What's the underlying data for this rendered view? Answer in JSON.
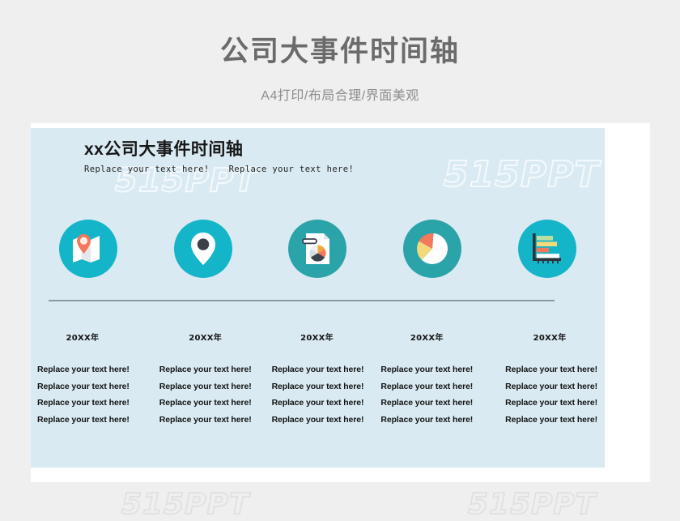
{
  "page": {
    "title": "公司大事件时间轴",
    "subtitle": "A4打印/布局合理/界面美观",
    "background_color": "#efefef",
    "title_color": "#6b6b6b",
    "subtitle_color": "#8d8d8d"
  },
  "watermarks": {
    "text": "515PPT",
    "slide_1": "515PPT",
    "slide_2": "515PPT",
    "page_1": "515PPT",
    "page_2": "515PPT"
  },
  "slide": {
    "background_color": "#d9eaf2",
    "card_color": "#ffffff",
    "title": "xx公司大事件时间轴",
    "subtitles": [
      "Replace your text here!",
      "Replace your text here!"
    ],
    "timeline_line_color": "#8c9aa0",
    "icons": [
      {
        "name": "map-with-pin-icon",
        "circle_color": "#14b5c8",
        "accent_color": "#f4785c"
      },
      {
        "name": "location-pin-icon",
        "circle_color": "#14b5c8",
        "accent_color": "#3a4149"
      },
      {
        "name": "document-pie-chart-icon",
        "circle_color": "#2aa4a8",
        "accent_color": "#f0a93c"
      },
      {
        "name": "pie-chart-icon",
        "circle_color": "#2aa4a8",
        "accent_color": "#f4785c"
      },
      {
        "name": "bar-chart-icon",
        "circle_color": "#14b5c8",
        "accent_color": "#f4785c"
      }
    ],
    "columns": [
      {
        "year": "20XX年",
        "lines": [
          "Replace your text here!",
          "Replace your text here!",
          "Replace your text here!",
          "Replace your text here!"
        ]
      },
      {
        "year": "20XX年",
        "lines": [
          "Replace your text here!",
          "Replace your text here!",
          "Replace your text here!",
          "Replace your text here!"
        ]
      },
      {
        "year": "20XX年",
        "lines": [
          "Replace your text here!",
          "Replace your text here!",
          "Replace your text here!",
          "Replace your text here!"
        ]
      },
      {
        "year": "20XX年",
        "lines": [
          "Replace your text here!",
          "Replace your text here!",
          "Replace your text here!",
          "Replace your text here!"
        ]
      },
      {
        "year": "20XX年",
        "lines": [
          "Replace your text here!",
          "Replace your text here!",
          "Replace your text here!",
          "Replace your text here!"
        ]
      }
    ]
  }
}
